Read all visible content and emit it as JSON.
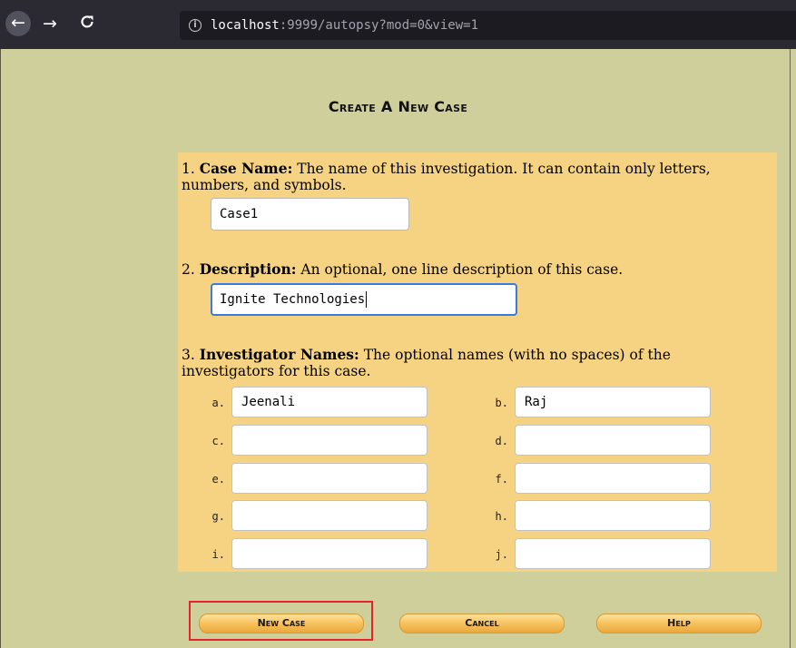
{
  "browser": {
    "url_host": "localhost",
    "url_rest": ":9999/autopsy?mod=0&view=1",
    "back_icon": "←",
    "forward_icon": "→",
    "reload_icon": "C",
    "info_icon": "i"
  },
  "page": {
    "title": "Create A New Case"
  },
  "case_name": {
    "number": "1.",
    "label": "Case Name:",
    "description": "The name of this investigation. It can contain only letters, numbers, and symbols.",
    "value": "Case1"
  },
  "description": {
    "number": "2.",
    "label": "Description:",
    "description": "An optional, one line description of this case.",
    "value": "Ignite Technologies"
  },
  "investigators": {
    "number": "3.",
    "label": "Investigator Names:",
    "description": "The optional names (with no spaces) of the investigators for this case.",
    "fields": [
      {
        "letter": "a.",
        "value": "Jeenali"
      },
      {
        "letter": "b.",
        "value": "Raj"
      },
      {
        "letter": "c.",
        "value": ""
      },
      {
        "letter": "d.",
        "value": ""
      },
      {
        "letter": "e.",
        "value": ""
      },
      {
        "letter": "f.",
        "value": ""
      },
      {
        "letter": "g.",
        "value": ""
      },
      {
        "letter": "h.",
        "value": ""
      },
      {
        "letter": "i.",
        "value": ""
      },
      {
        "letter": "j.",
        "value": ""
      }
    ]
  },
  "buttons": {
    "new_case": "New Case",
    "cancel": "Cancel",
    "help": "Help"
  },
  "colors": {
    "page_bg": "#cfcf9c",
    "panel_bg": "#f5d382",
    "focus_ring": "#3b7bdc",
    "highlight": "#e3242b"
  }
}
